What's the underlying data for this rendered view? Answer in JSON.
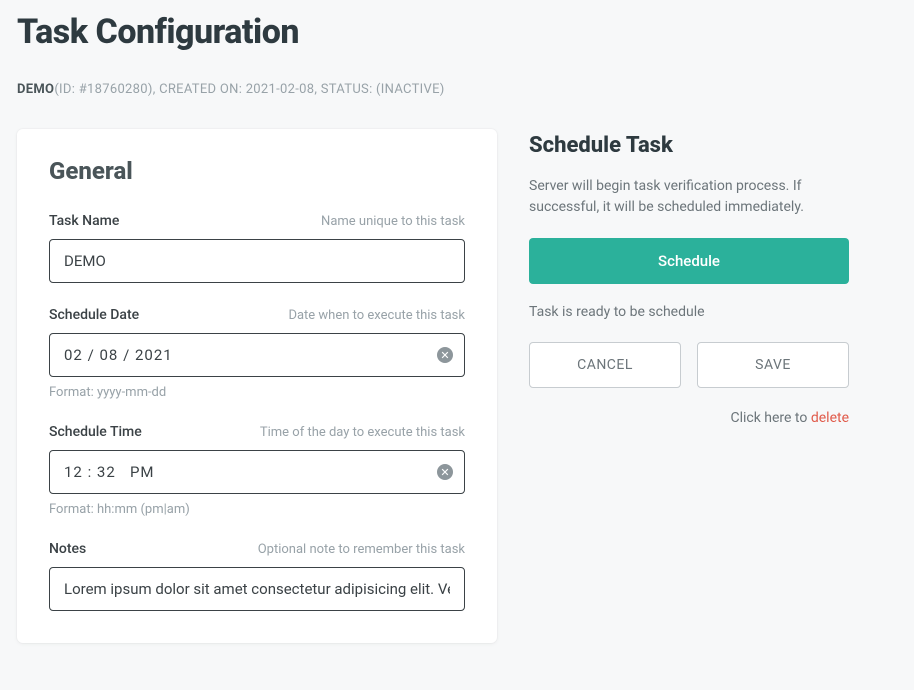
{
  "page": {
    "title": "Task Configuration"
  },
  "meta": {
    "name": "DEMO",
    "id_label": "(ID: #",
    "id": "18760280",
    "created_label": "), CREATED ON: ",
    "created": "2021-02-08",
    "status_label": ", STATUS: (",
    "status": "INACTIVE",
    "close": ")"
  },
  "general": {
    "title": "General",
    "task_name": {
      "label": "Task Name",
      "hint": "Name unique to this task",
      "value": "DEMO"
    },
    "schedule_date": {
      "label": "Schedule Date",
      "hint": "Date when to execute this task",
      "value": "02 / 08 / 2021",
      "help": "Format: yyyy-mm-dd"
    },
    "schedule_time": {
      "label": "Schedule Time",
      "hint": "Time of the day to execute this task",
      "value": "12 : 32   PM",
      "help": "Format: hh:mm (pm|am)"
    },
    "notes": {
      "label": "Notes",
      "hint": "Optional note to remember this task",
      "value": "Lorem ipsum dolor sit amet consectetur adipisicing elit. Venia"
    }
  },
  "schedule": {
    "title": "Schedule Task",
    "description": "Server will begin task verification process. If successful, it will be scheduled immediately.",
    "button": "Schedule",
    "status": "Task is ready to be schedule",
    "cancel": "CANCEL",
    "save": "SAVE",
    "delete_prefix": "Click here to ",
    "delete": "delete"
  }
}
